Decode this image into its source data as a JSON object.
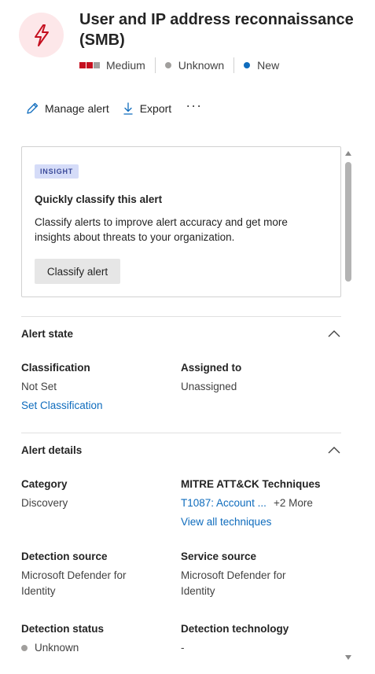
{
  "alert": {
    "icon": "lightning-icon",
    "title": "User and IP address reconnaissance (SMB)",
    "severity": "Medium",
    "severity_colors": [
      "#c50f1f",
      "#c50f1f",
      "#a19f9d"
    ],
    "detection_status": "Unknown",
    "status": "New",
    "unknown_dot_color": "#a19f9d",
    "new_dot_color": "#0f6cbd"
  },
  "toolbar": {
    "manage_label": "Manage alert",
    "export_label": "Export",
    "more_label": "···"
  },
  "insight": {
    "badge": "INSIGHT",
    "title": "Quickly classify this alert",
    "text": "Classify alerts to improve alert accuracy and get more insights about threats to your organization.",
    "button": "Classify alert"
  },
  "alert_state": {
    "title": "Alert state",
    "classification_label": "Classification",
    "classification_value": "Not Set",
    "set_classification_link": "Set Classification",
    "assigned_label": "Assigned to",
    "assigned_value": "Unassigned"
  },
  "alert_details": {
    "title": "Alert details",
    "category_label": "Category",
    "category_value": "Discovery",
    "mitre_label": "MITRE ATT&CK Techniques",
    "mitre_technique": "T1087: Account ...",
    "mitre_more": "+2 More",
    "view_all_link": "View all techniques",
    "detection_source_label": "Detection source",
    "detection_source_value": "Microsoft Defender for Identity",
    "service_source_label": "Service source",
    "service_source_value": "Microsoft Defender for Identity",
    "detection_status_label": "Detection status",
    "detection_status_value": "Unknown",
    "detection_tech_label": "Detection technology",
    "detection_tech_value": "-"
  }
}
